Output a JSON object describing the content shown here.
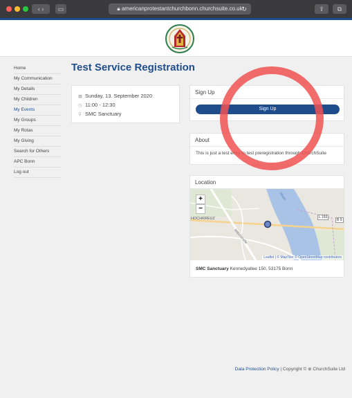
{
  "browser": {
    "url": "americanprotestantchurchbonn.churchsuite.co.uk"
  },
  "sidebar": {
    "items": [
      {
        "label": "Home"
      },
      {
        "label": "My Communication"
      },
      {
        "label": "My Details"
      },
      {
        "label": "My Children"
      },
      {
        "label": "My Events"
      },
      {
        "label": "My Groups"
      },
      {
        "label": "My Rotas"
      },
      {
        "label": "My Giving"
      },
      {
        "label": "Search for Others"
      },
      {
        "label": "APC Bonn"
      },
      {
        "label": "Log out"
      }
    ],
    "active_index": 4
  },
  "page": {
    "title": "Test Service Registration"
  },
  "event": {
    "date": "Sunday, 13. September 2020",
    "time": "11:00 - 12:30",
    "location": "SMC Sanctuary"
  },
  "signup": {
    "heading": "Sign Up",
    "button_label": "Sign Up"
  },
  "about": {
    "heading": "About",
    "text": "This is just a test entry to test preregistration through ChurchSuite"
  },
  "location": {
    "heading": "Location",
    "venue": "SMC Sanctuary",
    "address": "Kennedyallee 150, 53175 Bonn",
    "map": {
      "zoom_in": "+",
      "zoom_out": "−",
      "attribution": "Leaflet | © MapTiler © OpenStreetMap contributors",
      "label_area": "HOCHKREUZ",
      "label_road1": "L 193",
      "label_road2": "B 9",
      "label_street": "Mittelstraße",
      "label_river": "Rhein"
    }
  },
  "footer": {
    "policy_link": "Data Protection Policy",
    "copyright": " | Copyright © ⊕ ChurchSuite Ltd"
  },
  "colors": {
    "brand": "#1f4d8c",
    "annotation": "#f05252",
    "river": "#a9c3e6"
  }
}
